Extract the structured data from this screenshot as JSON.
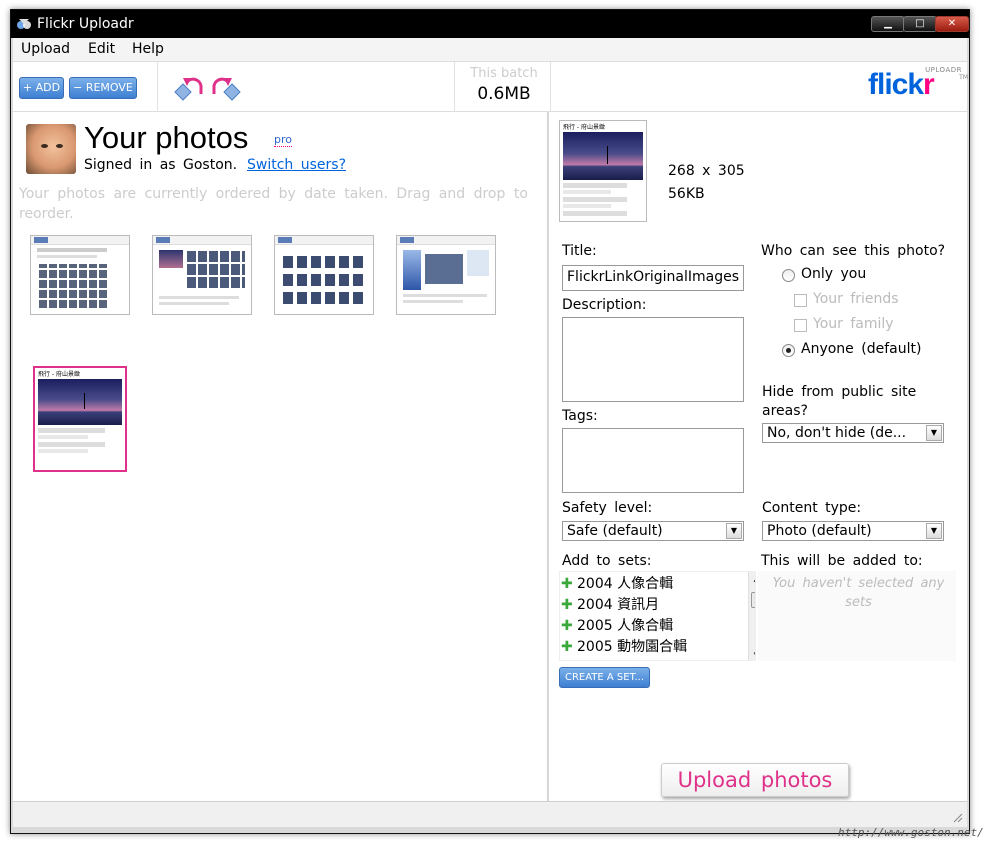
{
  "window": {
    "title": "Flickr Uploadr",
    "minimize": "▁",
    "maximize": "□",
    "close": "✕"
  },
  "menu": [
    "Upload",
    "Edit",
    "Help"
  ],
  "toolbar": {
    "add_label": "+ ADD",
    "remove_label": "− REMOVE",
    "batch_label": "This batch",
    "batch_size": "0.6MB",
    "logo_text_blue": "flick",
    "logo_text_pink": "r",
    "logo_sub": "UPLOADR",
    "logo_tm": "TM"
  },
  "left": {
    "title": "Your photos",
    "pro": "pro",
    "signed_in": "Signed in as Goston.",
    "switch_users": "Switch users?",
    "order_info": "Your photos are currently ordered by date taken. Drag and drop to reorder.",
    "selected_photo": {
      "header": "飛行 - 府山景緻",
      "caption1": "click here to add a description",
      "caption2": "This photo is public. Change?",
      "caption3": "Uploaded on Jul 7, 2007 | Map |",
      "caption4": "Delete",
      "caption5": "11 views / 1 comment"
    }
  },
  "details": {
    "dimensions": "268 x 305",
    "filesize": "56KB",
    "title_label": "Title:",
    "title_value": "FlickrLinkOriginalImages",
    "description_label": "Description:",
    "tags_label": "Tags:",
    "privacy_label": "Who can see this photo?",
    "privacy_options": {
      "only_you": "Only you",
      "friends": "Your friends",
      "family": "Your family",
      "anyone": "Anyone (default)"
    },
    "hide_label": "Hide from public site areas?",
    "hide_value": "No, don't hide (de...",
    "safety_label": "Safety level:",
    "safety_value": "Safe (default)",
    "content_label": "Content type:",
    "content_value": "Photo (default)",
    "sets_label": "Add to sets:",
    "sets": [
      "2004 人像合輯",
      "2004 資訊月",
      "2005 人像合輯",
      "2005 動物園合輯"
    ],
    "added_label": "This will be added to:",
    "added_empty": "You haven't selected any sets",
    "create_set": "CREATE A SET...",
    "upload_button": "Upload photos"
  },
  "watermark": "http://www.goston.net/"
}
